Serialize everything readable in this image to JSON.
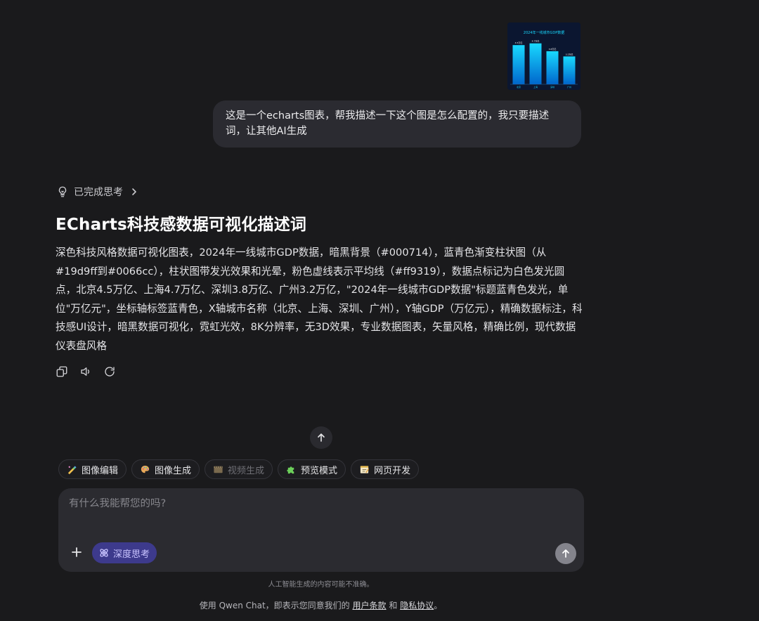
{
  "user_message": {
    "attachment": {
      "title": "2024年一线城市GDP数据",
      "categories": [
        "北京",
        "上海",
        "深圳",
        "广州"
      ],
      "values": [
        4.5,
        4.7,
        3.8,
        3.2
      ],
      "value_labels": [
        "4.5万亿",
        "4.7万亿",
        "3.8万亿",
        "3.2万亿"
      ],
      "colors": {
        "bar_top": "#19d9ff",
        "bar_bottom": "#0066cc",
        "background": "#000714",
        "avg_line": "#ff9319"
      }
    },
    "text": "这是一个echarts图表，帮我描述一下这个图是怎么配置的，我只要描述词，让其他AI生成"
  },
  "assistant": {
    "thinking_label": "已完成思考",
    "title": "ECharts科技感数据可视化描述词",
    "body": "深色科技风格数据可视化图表，2024年一线城市GDP数据，暗黑背景（#000714），蓝青色渐变柱状图（从#19d9ff到#0066cc），柱状图带发光效果和光晕，粉色虚线表示平均线（#ff9319），数据点标记为白色发光圆点，北京4.5万亿、上海4.7万亿、深圳3.8万亿、广州3.2万亿，\"2024年一线城市GDP数据\"标题蓝青色发光，单位\"万亿元\"，坐标轴标签蓝青色，X轴城市名称（北京、上海、深圳、广州），Y轴GDP（万亿元），精确数据标注，科技感UI设计，暗黑数据可视化，霓虹光效，8K分辨率，无3D效果，专业数据图表，矢量风格，精确比例，现代数据仪表盘风格"
  },
  "tools": [
    {
      "label": "图像编辑",
      "icon": "image-edit-icon",
      "enabled": true
    },
    {
      "label": "图像生成",
      "icon": "palette-icon",
      "enabled": true
    },
    {
      "label": "视频生成",
      "icon": "film-icon",
      "enabled": false
    },
    {
      "label": "预览模式",
      "icon": "puzzle-icon",
      "enabled": true
    },
    {
      "label": "网页开发",
      "icon": "webdev-icon",
      "enabled": true
    }
  ],
  "composer": {
    "placeholder": "有什么我能帮您的吗?",
    "deep_think_label": "深度思考"
  },
  "footer": {
    "disclaimer": "人工智能生成的内容可能不准确。",
    "terms_prefix": "使用 Qwen Chat，即表示您同意我们的",
    "terms_link": "用户条款",
    "and": "和",
    "privacy_link": "隐私协议",
    "suffix": "。"
  }
}
